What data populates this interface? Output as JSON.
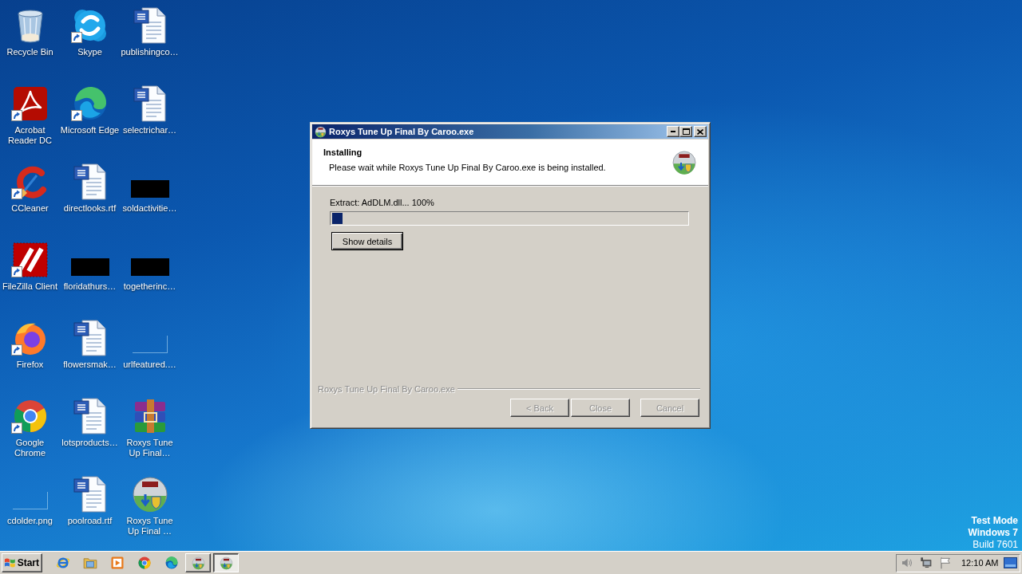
{
  "desktop": {
    "icons": [
      {
        "label": "Recycle Bin",
        "kind": "recycle-bin",
        "shortcut": false
      },
      {
        "label": "Acrobat Reader DC",
        "kind": "acrobat",
        "shortcut": true
      },
      {
        "label": "CCleaner",
        "kind": "ccleaner",
        "shortcut": true
      },
      {
        "label": "FileZilla Client",
        "kind": "filezilla",
        "shortcut": true
      },
      {
        "label": "Firefox",
        "kind": "firefox",
        "shortcut": true
      },
      {
        "label": "Google Chrome",
        "kind": "chrome",
        "shortcut": true
      },
      {
        "label": "cdolder.png",
        "kind": "blank-thumbnail",
        "shortcut": false
      },
      {
        "label": "Skype",
        "kind": "skype",
        "shortcut": true
      },
      {
        "label": "Microsoft Edge",
        "kind": "edge",
        "shortcut": true
      },
      {
        "label": "directlooks.rtf",
        "kind": "word-document",
        "shortcut": false
      },
      {
        "label": "floridathurs…",
        "kind": "redacted-thumbnail",
        "shortcut": false
      },
      {
        "label": "flowersmak…",
        "kind": "word-document",
        "shortcut": false
      },
      {
        "label": "lotsproducts…",
        "kind": "word-document",
        "shortcut": false
      },
      {
        "label": "poolroad.rtf",
        "kind": "word-document",
        "shortcut": false
      },
      {
        "label": "publishingco…",
        "kind": "word-document",
        "shortcut": false
      },
      {
        "label": "selectrichar…",
        "kind": "word-document",
        "shortcut": false
      },
      {
        "label": "soldactivitie…",
        "kind": "redacted-thumbnail",
        "shortcut": false
      },
      {
        "label": "togetherinc…",
        "kind": "redacted-thumbnail",
        "shortcut": false
      },
      {
        "label": "urlfeatured.…",
        "kind": "blank-thumbnail",
        "shortcut": false
      },
      {
        "label": "Roxys Tune Up Final…",
        "kind": "archive",
        "shortcut": false
      },
      {
        "label": "Roxys Tune Up Final …",
        "kind": "installer",
        "shortcut": false
      }
    ]
  },
  "window": {
    "title": "Roxys Tune Up Final By Caroo.exe",
    "header": {
      "title": "Installing",
      "subtitle": "Please wait while Roxys Tune Up Final By Caroo.exe is being installed."
    },
    "progress": {
      "status": "Extract: AdDLM.dll... 100%",
      "level": 0.03
    },
    "details_button": "Show details",
    "branding": "Roxys Tune Up Final By Caroo.exe",
    "buttons": [
      {
        "label": "< Back",
        "disabled": true
      },
      {
        "label": "Close",
        "disabled": true
      },
      {
        "label": "Cancel",
        "disabled": true
      }
    ]
  },
  "system_info": {
    "mode": "Test Mode",
    "os": "Windows 7",
    "build": "Build 7601"
  },
  "taskbar": {
    "start_label": "Start",
    "quick_launch": [
      {
        "kind": "ie"
      },
      {
        "kind": "folder"
      },
      {
        "kind": "media"
      },
      {
        "kind": "chrome"
      },
      {
        "kind": "edge"
      }
    ],
    "tasks": [
      {
        "kind": "installer",
        "selected": false
      },
      {
        "kind": "installer",
        "selected": true
      }
    ],
    "tray": {
      "icons": [
        {
          "kind": "speaker"
        },
        {
          "kind": "network"
        },
        {
          "kind": "flag"
        }
      ],
      "clock": "12:10 AM"
    }
  }
}
